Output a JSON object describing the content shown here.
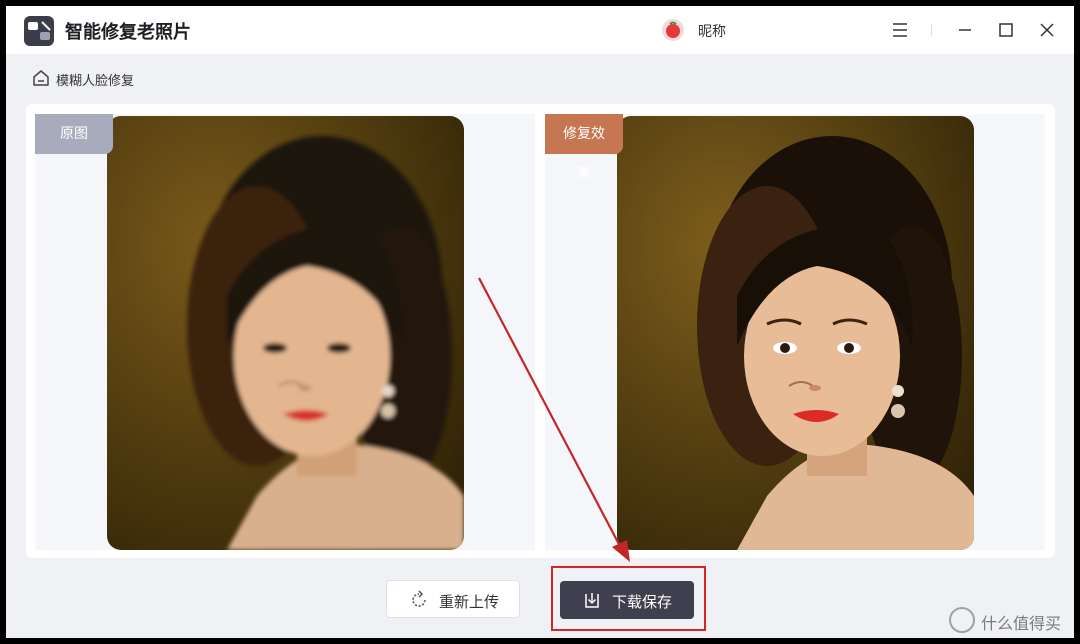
{
  "app": {
    "title": "智能修复老照片",
    "user_name": "昵称",
    "logo_icon": "app-logo-icon",
    "menu_icon": "hamburger-menu-icon",
    "minimize_icon": "minimize-icon",
    "maximize_icon": "maximize-icon",
    "close_icon": "close-icon"
  },
  "breadcrumb": {
    "icon": "home-icon",
    "label": "模糊人脸修复"
  },
  "panels": {
    "original_label": "原图",
    "result_label": "修复效果",
    "original_tag_color": "#a7abbb",
    "result_tag_color": "#c67651"
  },
  "actions": {
    "reupload_label": "重新上传",
    "reupload_icon": "refresh-icon",
    "download_label": "下载保存",
    "download_icon": "download-icon"
  },
  "annotation": {
    "highlight_color": "#d3262a"
  },
  "watermark": {
    "text": "什么值得买"
  }
}
